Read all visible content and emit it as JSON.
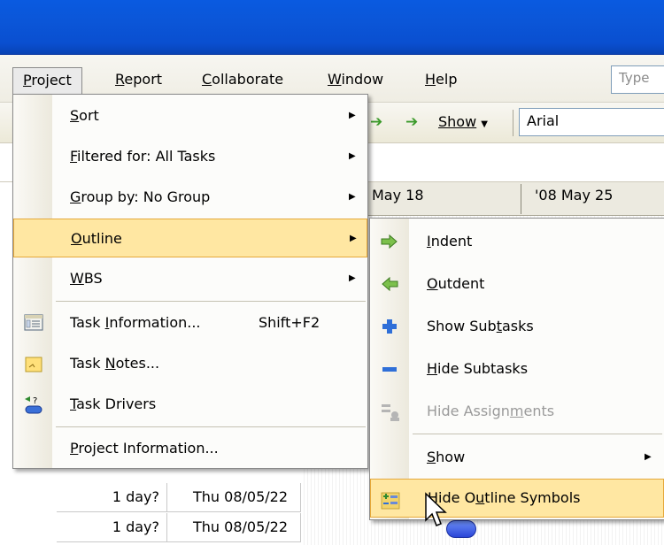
{
  "menubar": {
    "items": [
      {
        "label_pre": "",
        "key": "P",
        "label_post": "roject"
      },
      {
        "label_pre": "",
        "key": "R",
        "label_post": "eport"
      },
      {
        "label_pre": "",
        "key": "C",
        "label_post": "ollaborate"
      },
      {
        "label_pre": "",
        "key": "W",
        "label_post": "indow"
      },
      {
        "label_pre": "",
        "key": "H",
        "label_post": "elp"
      }
    ],
    "type_question": "Type"
  },
  "toolbar": {
    "show_label": "Show",
    "font_name": "Arial"
  },
  "gantt": {
    "weeks": [
      "May 18",
      "'08 May 25"
    ]
  },
  "rows": [
    {
      "duration": "1 day?",
      "start": "Thu 08/05/22"
    },
    {
      "duration": "1 day?",
      "start": "Thu 08/05/22"
    }
  ],
  "project_menu": {
    "items": [
      {
        "pre": "",
        "key": "S",
        "post": "ort",
        "shortcut": "",
        "submenu": true
      },
      {
        "pre": "",
        "key": "F",
        "post": "iltered for: All Tasks",
        "shortcut": "",
        "submenu": true
      },
      {
        "pre": "",
        "key": "G",
        "post": "roup by: No Group",
        "shortcut": "",
        "submenu": true
      },
      {
        "pre": "",
        "key": "O",
        "post": "utline",
        "shortcut": "",
        "submenu": true
      },
      {
        "pre": "",
        "key": "W",
        "post": "BS",
        "shortcut": "",
        "submenu": true
      },
      {
        "pre": "Task ",
        "key": "I",
        "post": "nformation...",
        "shortcut": "Shift+F2",
        "submenu": false
      },
      {
        "pre": "Task ",
        "key": "N",
        "post": "otes...",
        "shortcut": "",
        "submenu": false
      },
      {
        "pre": "",
        "key": "T",
        "post": "ask Drivers",
        "shortcut": "",
        "submenu": false
      },
      {
        "pre": "",
        "key": "P",
        "post": "roject Information...",
        "shortcut": "",
        "submenu": false
      }
    ]
  },
  "outline_submenu": {
    "items": [
      {
        "pre": "",
        "key": "I",
        "post": "ndent",
        "submenu": false
      },
      {
        "pre": "",
        "key": "O",
        "post": "utdent",
        "submenu": false
      },
      {
        "pre": "Show Sub",
        "key": "t",
        "post": "asks",
        "submenu": false
      },
      {
        "pre": "",
        "key": "H",
        "post": "ide Subtasks",
        "submenu": false
      },
      {
        "pre": "Hide Assign",
        "key": "m",
        "post": "ents",
        "submenu": false
      },
      {
        "pre": "",
        "key": "S",
        "post": "how",
        "submenu": true
      },
      {
        "pre": "Hide O",
        "key": "u",
        "post": "tline Symbols",
        "submenu": false
      }
    ]
  },
  "colors": {
    "title_bar": "#0a5ae0",
    "highlight": "#ffe7a2",
    "highlight_border": "#e5a83a"
  }
}
